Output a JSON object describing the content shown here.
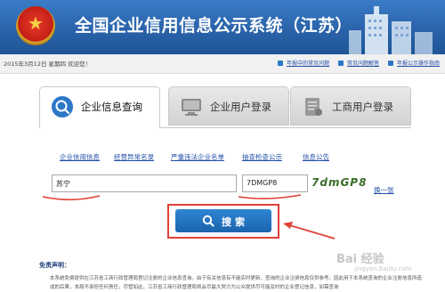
{
  "header": {
    "title": "全国企业信用信息公示系统（江苏）"
  },
  "infobar": {
    "date": "2015年3月12日 星期四 欢迎您！",
    "links": [
      "年报中的常见问题",
      "常见问题解答",
      "年报公示操作指南"
    ]
  },
  "tabs": [
    {
      "label": "企业信息查询",
      "active": true
    },
    {
      "label": "企业用户登录",
      "active": false
    },
    {
      "label": "工商用户登录",
      "active": false
    }
  ],
  "subnav": [
    "企业信用信息",
    "经营异常名录",
    "严重违法企业名单",
    "抽查检查公示",
    "信息公告"
  ],
  "search": {
    "keyword_value": "苏宁",
    "captcha_input_value": "7DMGP8",
    "captcha_image_text": "7dmGP8",
    "change_label": "换一张",
    "button_label": "搜索"
  },
  "disclaimer": {
    "title": "免责声明：",
    "text": "本系统免费提供在江苏省工商行政管理局登记注册的企业信息查询。由于有关信息有不能实时更新，查询的企业注册信息仅供参考。因此用于本系统查询的企业注册信息所造成的后果，本局不承担任何责任，尽管如此，江苏省工商行政管理局将会尽最大努力为公众提供尽可能及时的企业登记信息，如需查询"
  },
  "watermark": {
    "main": "Bai 经验",
    "sub": "jingyan.baidu.com"
  },
  "colors": {
    "header_blue": "#2a63aa",
    "link_blue": "#1f4ea8",
    "annotation_red": "#e04038",
    "button_blue": "#1b63ad"
  }
}
